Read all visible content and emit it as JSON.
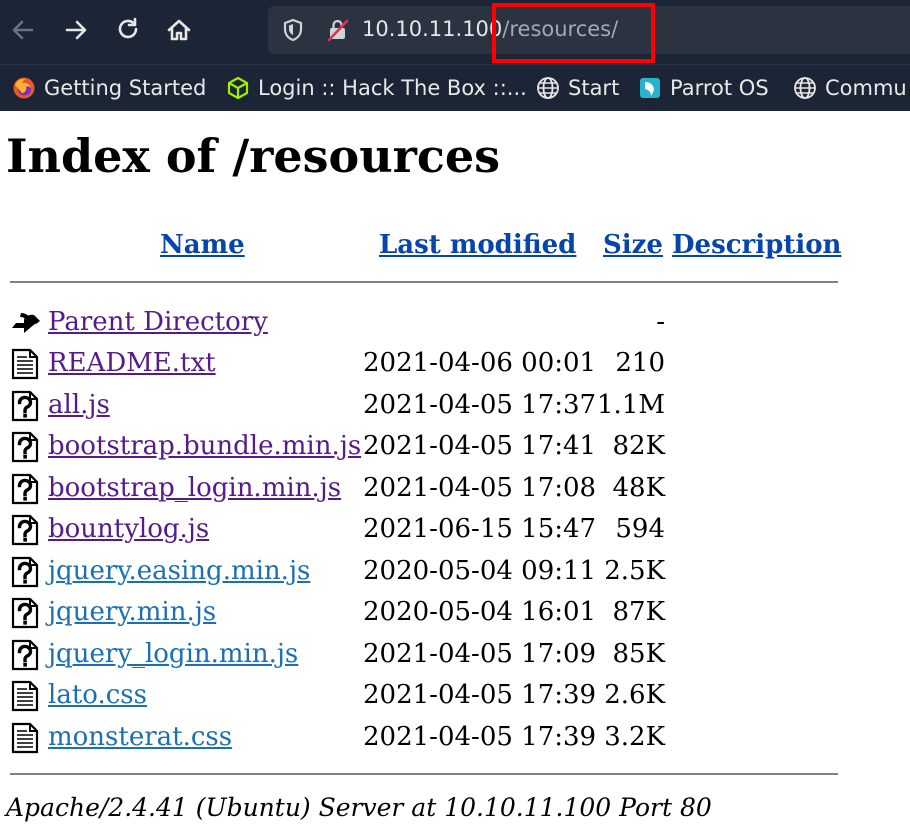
{
  "browser": {
    "url_host": "10.10.11.100",
    "url_path": "/resources/",
    "bookmarks": [
      {
        "label": "Getting Started",
        "icon": "firefox-icon"
      },
      {
        "label": "Login :: Hack The Box ::...",
        "icon": "htb-cube-icon"
      },
      {
        "label": "Start",
        "icon": "globe-icon"
      },
      {
        "label": "Parrot OS",
        "icon": "parrot-icon"
      },
      {
        "label": "Commu",
        "icon": "globe-icon"
      }
    ],
    "highlight_color": "#ff0000"
  },
  "page": {
    "title": "Index of /resources",
    "columns": {
      "name": "Name",
      "last_modified": "Last modified",
      "size": "Size",
      "description": "Description"
    },
    "parent": {
      "name": "Parent Directory",
      "size": "-"
    },
    "files": [
      {
        "name": "README.txt",
        "date": "2021-04-06 00:01",
        "size": "210",
        "icon": "text-file-icon"
      },
      {
        "name": "all.js",
        "date": "2021-04-05 17:37",
        "size": "1.1M",
        "icon": "unknown-file-icon"
      },
      {
        "name": "bootstrap.bundle.min.js",
        "date": "2021-04-05 17:41",
        "size": "82K",
        "icon": "unknown-file-icon"
      },
      {
        "name": "bootstrap_login.min.js",
        "date": "2021-04-05 17:08",
        "size": "48K",
        "icon": "unknown-file-icon"
      },
      {
        "name": "bountylog.js",
        "date": "2021-06-15 15:47",
        "size": "594",
        "icon": "unknown-file-icon"
      },
      {
        "name": "jquery.easing.min.js",
        "date": "2020-05-04 09:11",
        "size": "2.5K",
        "icon": "unknown-file-icon"
      },
      {
        "name": "jquery.min.js",
        "date": "2020-05-04 16:01",
        "size": "87K",
        "icon": "unknown-file-icon"
      },
      {
        "name": "jquery_login.min.js",
        "date": "2021-04-05 17:09",
        "size": "85K",
        "icon": "unknown-file-icon"
      },
      {
        "name": "lato.css",
        "date": "2021-04-05 17:39",
        "size": "2.6K",
        "icon": "text-file-icon"
      },
      {
        "name": "monsterat.css",
        "date": "2021-04-05 17:39",
        "size": "3.2K",
        "icon": "text-file-icon"
      }
    ],
    "server_signature": "Apache/2.4.41 (Ubuntu) Server at 10.10.11.100 Port 80"
  }
}
